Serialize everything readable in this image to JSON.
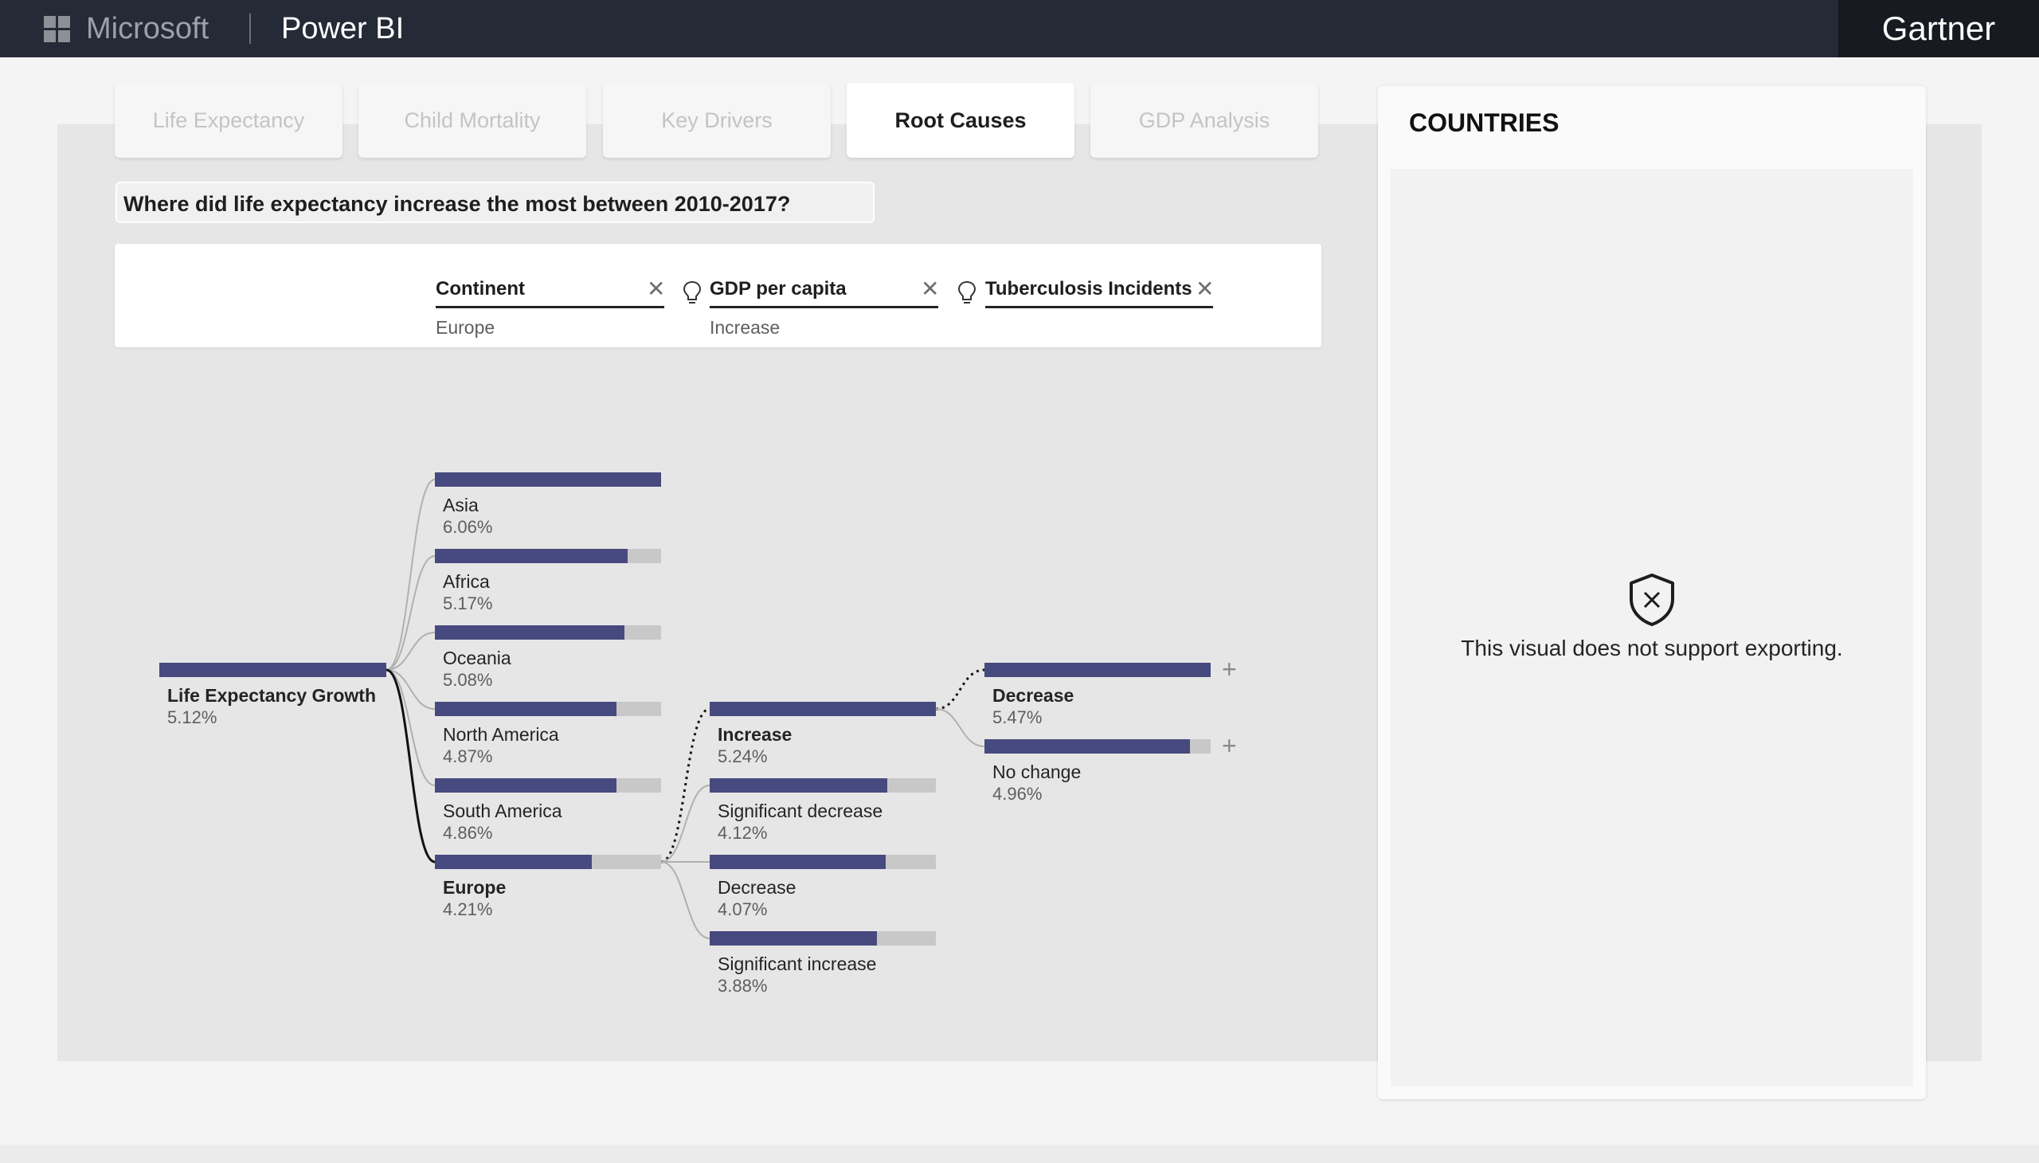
{
  "topbar": {
    "brand": "Microsoft",
    "product": "Power BI",
    "partner": "Gartner"
  },
  "tabs": [
    {
      "label": "Life Expectancy",
      "active": false
    },
    {
      "label": "Child Mortality",
      "active": false
    },
    {
      "label": "Key Drivers",
      "active": false
    },
    {
      "label": "Root Causes",
      "active": true
    },
    {
      "label": "GDP Analysis",
      "active": false
    }
  ],
  "question": "Where did life expectancy increase the most between 2010-2017?",
  "filters": [
    {
      "name": "Continent",
      "value": "Europe"
    },
    {
      "name": "GDP per capita",
      "value": "Increase"
    },
    {
      "name": "Tuberculosis Incidents",
      "value": ""
    }
  ],
  "tree": {
    "root": {
      "label": "Life Expectancy Growth",
      "value": "5.12%",
      "fraction": 1.0
    },
    "continents": [
      {
        "label": "Asia",
        "value": "6.06%",
        "fraction": 1.0
      },
      {
        "label": "Africa",
        "value": "5.17%",
        "fraction": 0.853
      },
      {
        "label": "Oceania",
        "value": "5.08%",
        "fraction": 0.838
      },
      {
        "label": "North America",
        "value": "4.87%",
        "fraction": 0.804
      },
      {
        "label": "South America",
        "value": "4.86%",
        "fraction": 0.802
      },
      {
        "label": "Europe",
        "value": "4.21%",
        "fraction": 0.695,
        "selected": true
      }
    ],
    "gdp": [
      {
        "label": "Increase",
        "value": "5.24%",
        "fraction": 1.0,
        "selected": true
      },
      {
        "label": "Significant decrease",
        "value": "4.12%",
        "fraction": 0.786
      },
      {
        "label": "Decrease",
        "value": "4.07%",
        "fraction": 0.777
      },
      {
        "label": "Significant increase",
        "value": "3.88%",
        "fraction": 0.74
      }
    ],
    "tb": [
      {
        "label": "Decrease",
        "value": "5.47%",
        "fraction": 1.0,
        "selected": true
      },
      {
        "label": "No change",
        "value": "4.96%",
        "fraction": 0.907
      }
    ],
    "colors": {
      "bar": "#474a7e",
      "track": "#c8c8c8"
    }
  },
  "countries_panel": {
    "title": "COUNTRIES",
    "message": "This visual does not support exporting."
  },
  "icons": [
    "windows-logo-icon",
    "close-icon",
    "lightbulb-icon",
    "plus-icon",
    "shield-x-icon"
  ]
}
